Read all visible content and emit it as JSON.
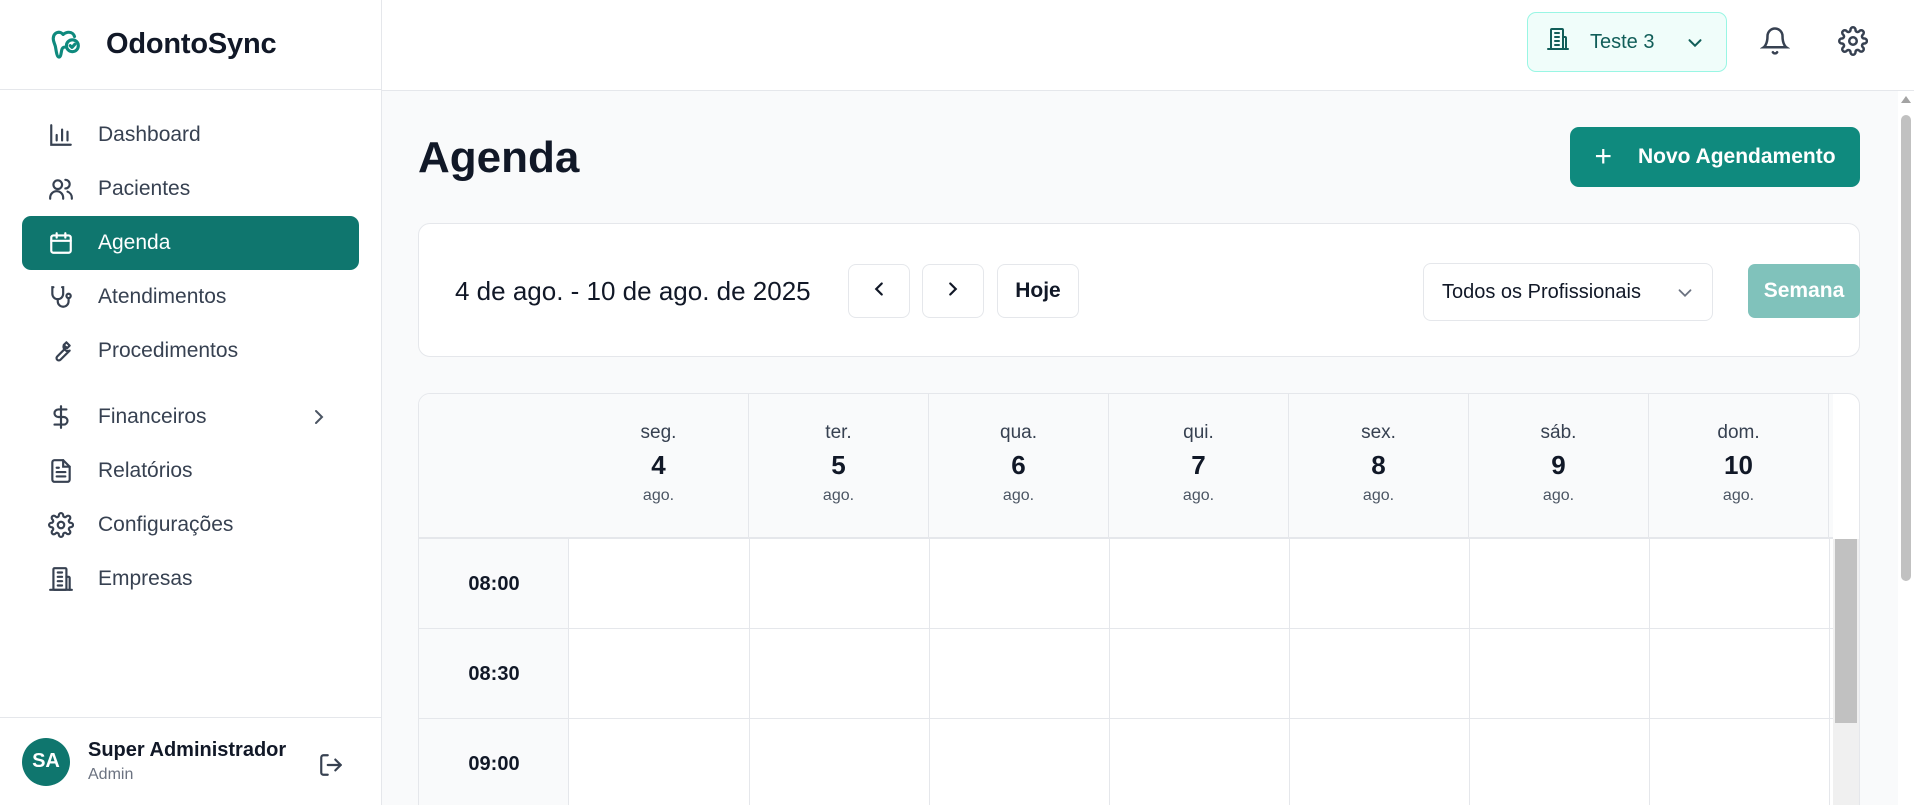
{
  "app": {
    "name": "OdontoSync"
  },
  "sidebar": {
    "items": [
      {
        "label": "Dashboard",
        "icon": "bar-chart-icon"
      },
      {
        "label": "Pacientes",
        "icon": "users-icon"
      },
      {
        "label": "Agenda",
        "icon": "calendar-icon",
        "active": true
      },
      {
        "label": "Atendimentos",
        "icon": "stethoscope-icon"
      },
      {
        "label": "Procedimentos",
        "icon": "wrench-icon"
      },
      {
        "label": "Financeiros",
        "icon": "dollar-icon",
        "has_submenu": true
      },
      {
        "label": "Relatórios",
        "icon": "file-text-icon"
      },
      {
        "label": "Configurações",
        "icon": "gear-icon"
      },
      {
        "label": "Empresas",
        "icon": "building-icon"
      }
    ],
    "user": {
      "initials": "SA",
      "name": "Super Administrador",
      "role": "Admin"
    }
  },
  "header": {
    "company": "Teste 3",
    "icons": [
      "bell-icon",
      "gear-icon"
    ]
  },
  "main": {
    "title": "Agenda",
    "new_button": "Novo Agendamento",
    "toolbar": {
      "range": "4 de ago. - 10 de ago. de 2025",
      "today": "Hoje",
      "professional": "Todos os Profissionais",
      "view": "Semana"
    },
    "calendar": {
      "days": [
        {
          "name": "seg.",
          "num": "4",
          "month": "ago."
        },
        {
          "name": "ter.",
          "num": "5",
          "month": "ago."
        },
        {
          "name": "qua.",
          "num": "6",
          "month": "ago."
        },
        {
          "name": "qui.",
          "num": "7",
          "month": "ago."
        },
        {
          "name": "sex.",
          "num": "8",
          "month": "ago."
        },
        {
          "name": "sáb.",
          "num": "9",
          "month": "ago."
        },
        {
          "name": "dom.",
          "num": "10",
          "month": "ago."
        }
      ],
      "slots": [
        "08:00",
        "08:30",
        "09:00"
      ]
    }
  },
  "colors": {
    "accent": "#0f766e",
    "button": "#0f8a7e",
    "week_button": "#80c2bb"
  }
}
